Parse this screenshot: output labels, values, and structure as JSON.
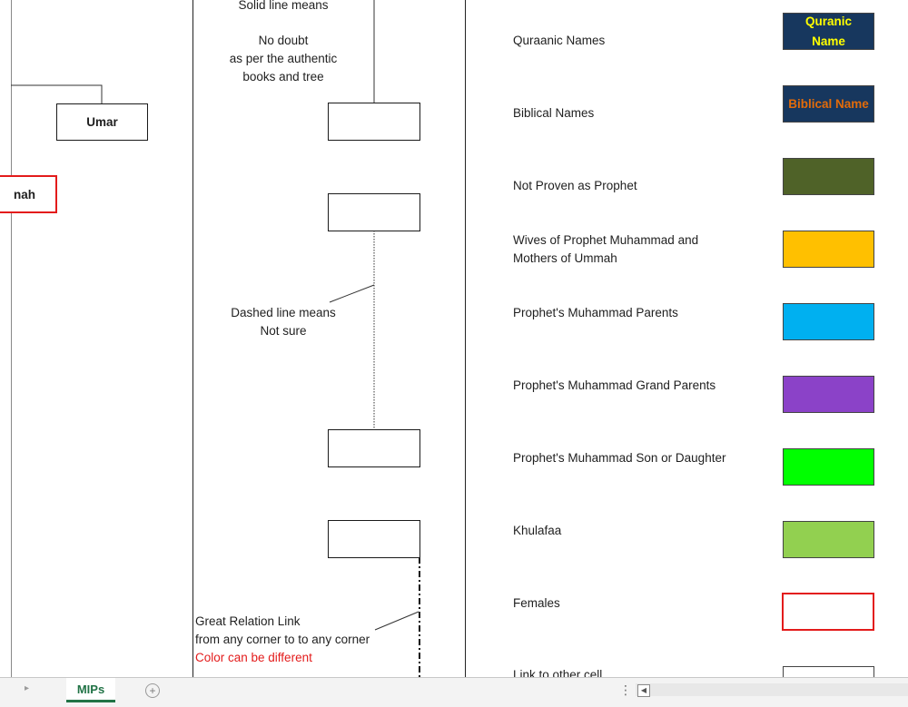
{
  "left_pane": {
    "umar_label": "Umar",
    "cut_label": "nah"
  },
  "middle_pane": {
    "solid_line_title": "Solid line means",
    "solid_line_desc": [
      "No doubt",
      "as per the authentic",
      "books and tree"
    ],
    "dashed_line_desc": [
      "Dashed line means",
      "Not sure"
    ],
    "relation_link_desc": [
      "Great Relation Link",
      "from any corner to to any corner"
    ],
    "relation_link_note": "Color can be different",
    "relation_link_note_color": "#e31b1b"
  },
  "legend": [
    {
      "label": "Quraanic Names",
      "swatch_text": "Quranic Name",
      "swatch_color": "#17375e",
      "text_color": "#ffff00"
    },
    {
      "label": "Biblical Names",
      "swatch_text": "Biblical Name",
      "swatch_color": "#17375e",
      "text_color": "#e26b0a"
    },
    {
      "label": "Not Proven as Prophet",
      "swatch_color": "#4f6228"
    },
    {
      "label": "Wives of Prophet Muhammad and",
      "label2": "Mothers of Ummah",
      "swatch_color": "#ffc000"
    },
    {
      "label": "Prophet's Muhammad Parents",
      "swatch_color": "#00b0f0"
    },
    {
      "label": "Prophet's Muhammad Grand Parents",
      "swatch_color": "#8b42c8"
    },
    {
      "label": "Prophet's Muhammad Son or Daughter",
      "swatch_color": "#00ff00"
    },
    {
      "label": "Khulafaa",
      "swatch_color": "#92d050"
    },
    {
      "label": "Females",
      "swatch_color": "#ffffff",
      "border_color": "#e31b1b"
    },
    {
      "label": "Link to other cell",
      "swatch_color": "#ffffff"
    }
  ],
  "tabbar": {
    "active_tab": "MIPs",
    "add_sheet_icon": "plus-circle-icon",
    "nav_icon": "caret-right-icon"
  }
}
